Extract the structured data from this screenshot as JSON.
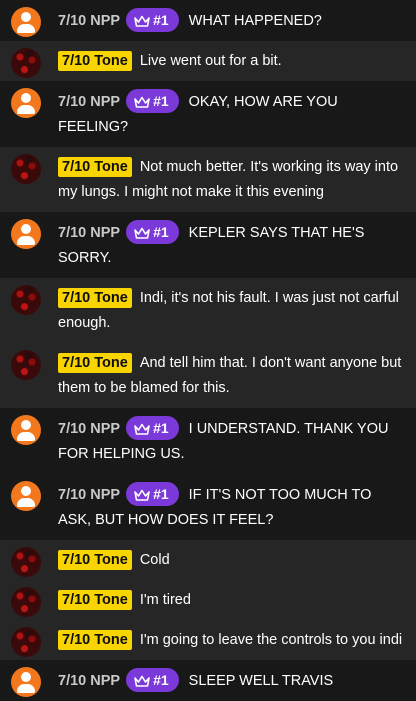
{
  "badge_label": "#1",
  "messages": [
    {
      "author": "7/10 NPP",
      "text": "WHAT HAPPENED?"
    },
    {
      "author": "7/10 Tone",
      "text": "Live went out for a bit."
    },
    {
      "author": "7/10 NPP",
      "text": "OKAY, HOW ARE YOU FEELING?"
    },
    {
      "author": "7/10 Tone",
      "text": "Not much better. It's working its way into my lungs. I might not make it this evening"
    },
    {
      "author": "7/10 NPP",
      "text": "KEPLER SAYS THAT HE'S SORRY."
    },
    {
      "author": "7/10 Tone",
      "text": "Indi, it's not his fault. I was just not carful enough."
    },
    {
      "author": "7/10 Tone",
      "text": "And tell him that. I don't want anyone but them to be blamed for this."
    },
    {
      "author": "7/10 NPP",
      "text": "I UNDERSTAND. THANK YOU FOR HELPING US."
    },
    {
      "author": "7/10 NPP",
      "text": "IF IT'S NOT TOO MUCH TO ASK, BUT HOW DOES IT FEEL?"
    },
    {
      "author": "7/10 Tone",
      "text": "Cold"
    },
    {
      "author": "7/10 Tone",
      "text": "I'm tired"
    },
    {
      "author": "7/10 Tone",
      "text": "I'm going to leave the controls to you indi"
    },
    {
      "author": "7/10 NPP",
      "text": "SLEEP WELL TRAVIS"
    }
  ],
  "colors": {
    "npp_avatar": "#f2771d",
    "tone_name_highlight": "#f8d400",
    "badge": "#7b39d9",
    "row_dark": "#181818",
    "row_light": "#262626"
  },
  "icons": {
    "avatar_npp": "user-avatar-icon",
    "avatar_tone": "user-avatar-icon",
    "badge": "crown-icon"
  }
}
